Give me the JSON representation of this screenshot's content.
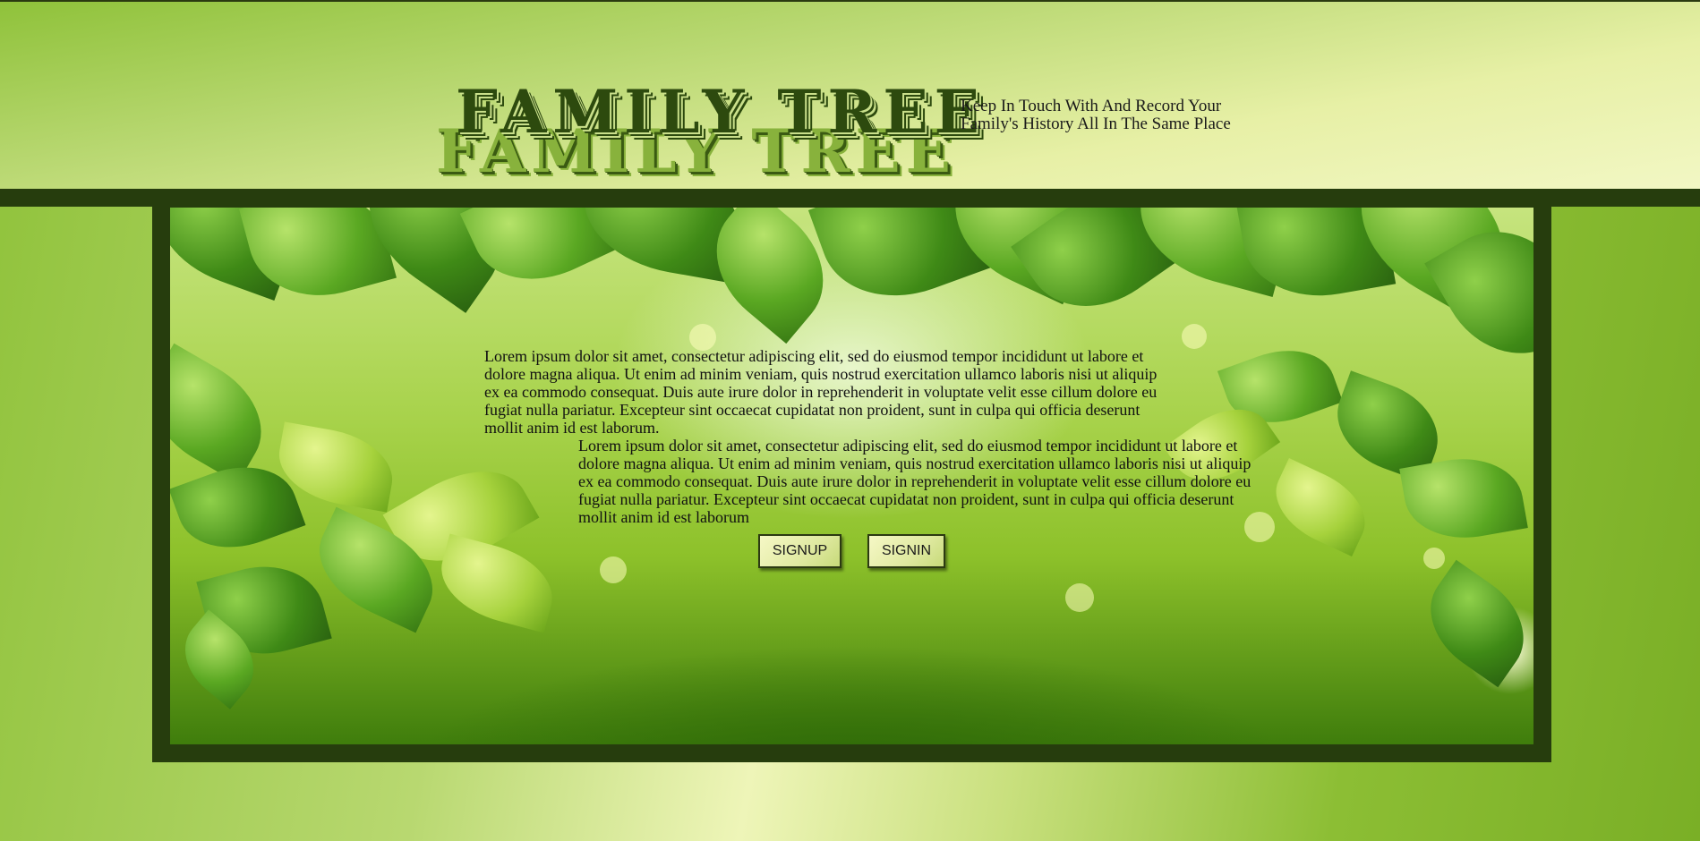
{
  "header": {
    "title": "FAMILY TREE",
    "title_shadow": "FAMILY TREE",
    "tagline_line1": "Keep In Touch With And Record Your",
    "tagline_line2": "Family's History All In The Same Place"
  },
  "main": {
    "paragraph1": "Lorem ipsum dolor sit amet, consectetur adipiscing elit, sed do eiusmod tempor incididunt ut labore et dolore magna aliqua. Ut enim ad minim veniam, quis nostrud exercitation ullamco laboris nisi ut aliquip ex ea commodo consequat. Duis aute irure dolor in reprehenderit in voluptate velit esse cillum dolore eu fugiat nulla pariatur. Excepteur sint occaecat cupidatat non proident, sunt in culpa qui officia deserunt mollit anim id est laborum.",
    "paragraph2": "Lorem ipsum dolor sit amet, consectetur adipiscing elit, sed do eiusmod tempor incididunt ut labore et dolore magna aliqua. Ut enim ad minim veniam, quis nostrud exercitation ullamco laboris nisi ut aliquip ex ea commodo consequat. Duis aute irure dolor in reprehenderit in voluptate velit esse cillum dolore eu fugiat nulla pariatur. Excepteur sint occaecat cupidatat non proident, sunt in culpa qui officia deserunt mollit anim id est laborum",
    "signup_label": "SIGNUP",
    "signin_label": "SIGNIN"
  },
  "colors": {
    "frame": "#263d0d",
    "title_dark": "#2d4a0e",
    "title_light": "#88b23c",
    "button_bg": "#dfe9a0"
  },
  "background_image": "green-leaves-bokeh"
}
